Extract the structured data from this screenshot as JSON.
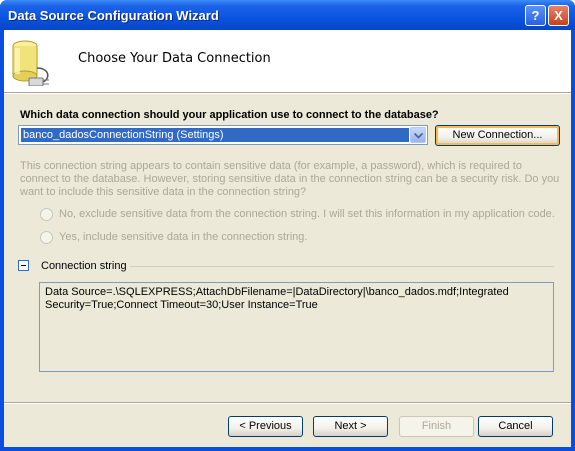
{
  "window": {
    "title": "Data Source Configuration Wizard",
    "help_label": "?",
    "close_label": "X"
  },
  "header": {
    "title": "Choose Your Data Connection",
    "icon": "database-plug-icon"
  },
  "question": "Which data connection should your application use to connect to the database?",
  "connection_select": {
    "selected": "banco_dadosConnectionString (Settings)"
  },
  "new_connection_label": "New Connection...",
  "sensitive_info": "This connection string appears to contain sensitive data (for example, a password), which is required to connect to the database. However, storing sensitive data in the connection string can be a security risk. Do you want to include this sensitive data in the connection string?",
  "options": [
    {
      "label": "No, exclude sensitive data from the connection string. I will set this information in my application code.",
      "enabled": false
    },
    {
      "label": "Yes, include sensitive data in the connection string.",
      "enabled": false
    }
  ],
  "connection_string_group": {
    "label": "Connection string",
    "expanded": true,
    "value": "Data Source=.\\SQLEXPRESS;AttachDbFilename=|DataDirectory|\\banco_dados.mdf;Integrated Security=True;Connect Timeout=30;User Instance=True"
  },
  "buttons": {
    "previous": "< Previous",
    "next": "Next >",
    "finish": "Finish",
    "cancel": "Cancel"
  },
  "colors": {
    "title_bar": "#0a54e0",
    "selection": "#316ac5",
    "dialog_bg": "#ece9d8"
  }
}
